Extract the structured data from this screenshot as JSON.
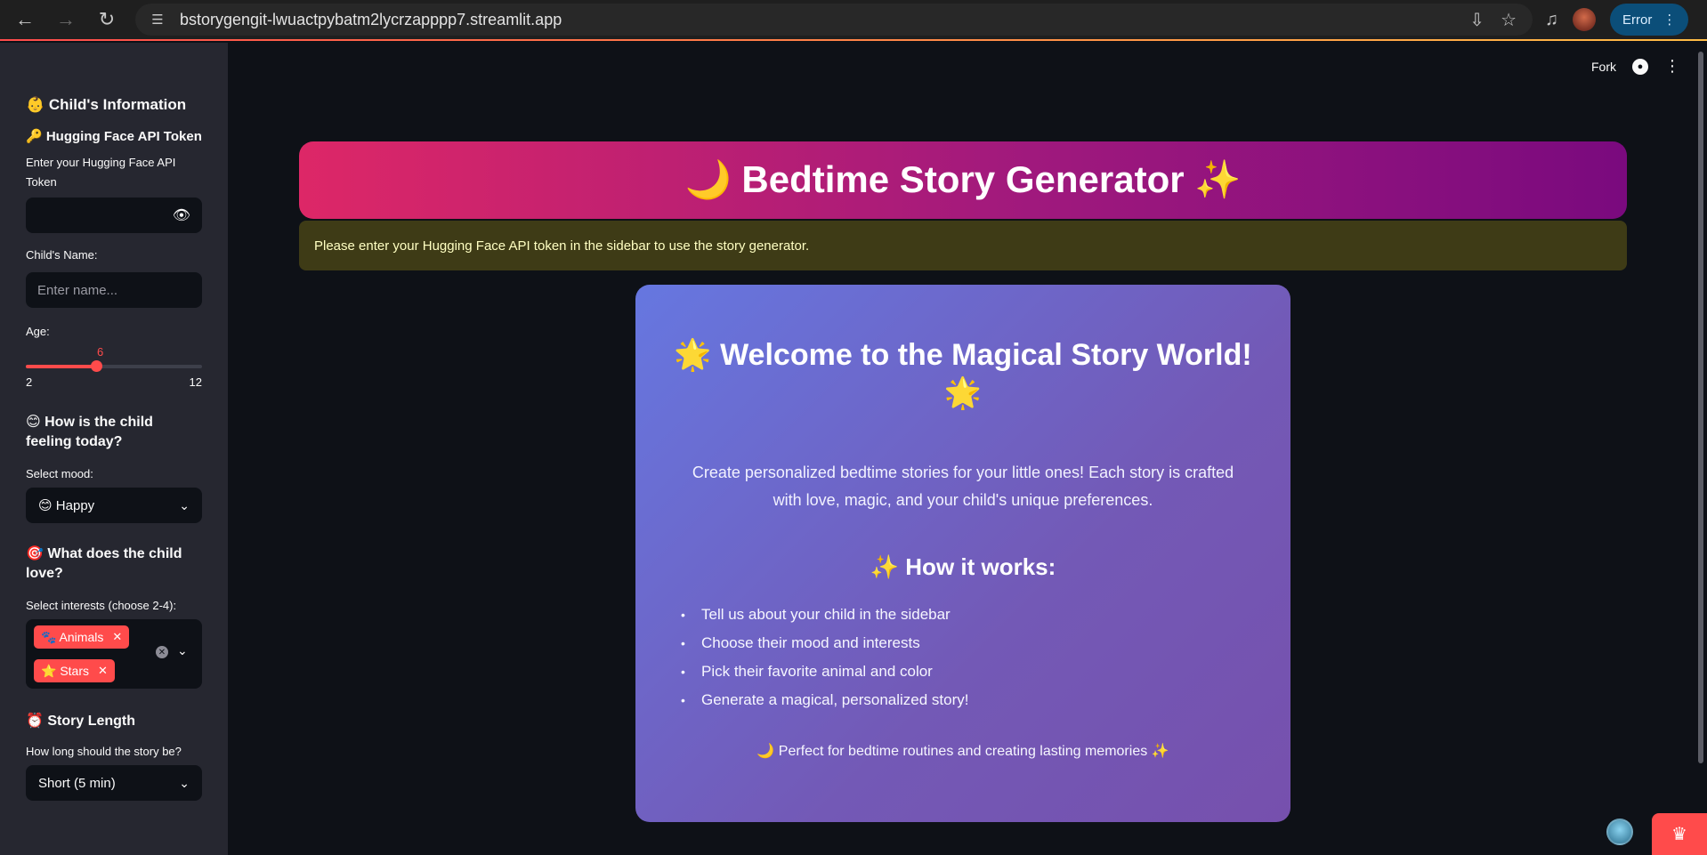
{
  "browser": {
    "url": "bstorygengit-lwuactpybatm2lycrzapppp7.streamlit.app",
    "error_label": "Error"
  },
  "topbar": {
    "fork_label": "Fork"
  },
  "sidebar": {
    "child_info_title": "👶 Child's Information",
    "token_section_title": "🔑 Hugging Face API Token",
    "token_label_line1": "Enter your Hugging Face API",
    "token_label_line2": "Token",
    "token_value": "",
    "name_label": "Child's Name:",
    "name_placeholder": "Enter name...",
    "age_label": "Age:",
    "age_value": "6",
    "age_min": "2",
    "age_max": "12",
    "age_fraction": 0.4,
    "mood_title_line1": "😊 How is the child",
    "mood_title_line2": "feeling today?",
    "mood_label": "Select mood:",
    "mood_selected": "😊 Happy",
    "interests_title_line1": "🎯 What does the child",
    "interests_title_line2": "love?",
    "interests_label": "Select interests (choose 2-4):",
    "interests_selected": [
      "🐾 Animals",
      "⭐ Stars"
    ],
    "length_title": "⏰ Story Length",
    "length_label": "How long should the story be?",
    "length_selected": "Short (5 min)"
  },
  "main": {
    "banner_title": "🌙 Bedtime Story Generator ✨",
    "warning_text": "Please enter your Hugging Face API token in the sidebar to use the story generator.",
    "welcome_title_line1": "🌟 Welcome to the Magical Story World!",
    "welcome_title_line2": "🌟",
    "welcome_desc_line1": "Create personalized bedtime stories for your little ones! Each story is crafted",
    "welcome_desc_line2": "with love, magic, and your child's unique preferences.",
    "how_title": "✨ How it works:",
    "how_steps": [
      "Tell us about your child in the sidebar",
      "Choose their mood and interests",
      "Pick their favorite animal and color",
      "Generate a magical, personalized story!"
    ],
    "footer_text": "🌙 Perfect for bedtime routines and creating lasting memories ✨"
  },
  "colors": {
    "accent": "#ff4b4b",
    "sidebar_bg": "#262730",
    "main_bg": "#0e1117",
    "banner_start": "#dd2767",
    "banner_end": "#7a0a7e",
    "card_start": "#6677e0",
    "card_end": "#7650ad",
    "warning_bg": "#3e3b16"
  },
  "icons": [
    "back-arrow-icon",
    "forward-arrow-icon",
    "reload-icon",
    "site-info-icon",
    "install-icon",
    "star-icon",
    "media-icon",
    "eye-icon",
    "chevron-down-icon",
    "clear-icon",
    "github-icon",
    "more-icon",
    "crown-icon"
  ]
}
